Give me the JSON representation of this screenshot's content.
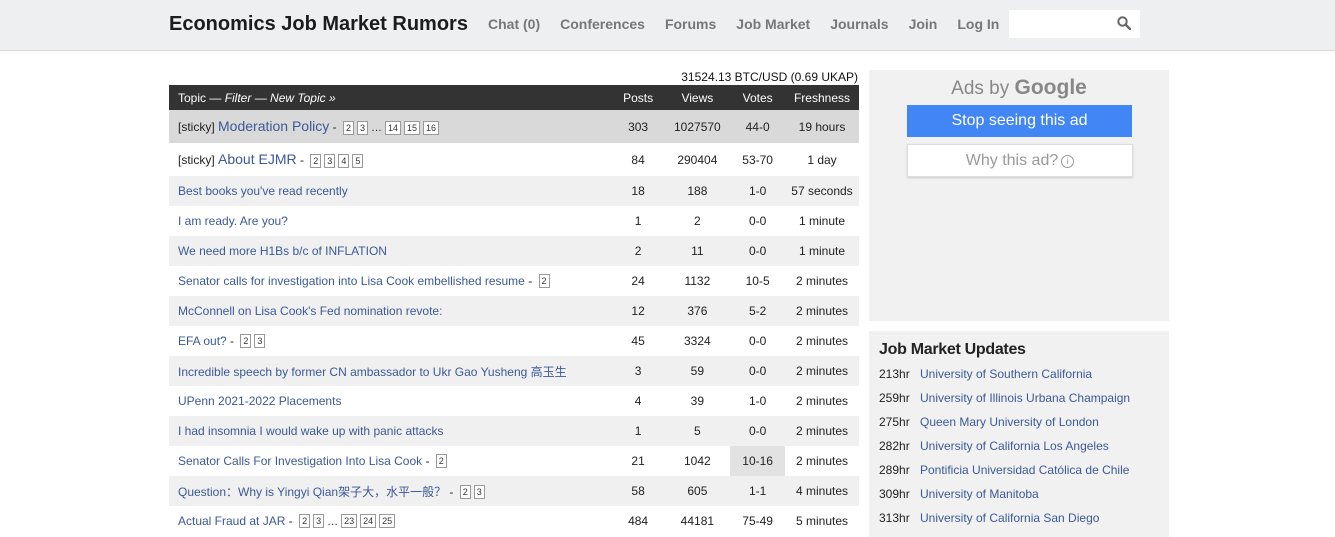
{
  "header": {
    "site_title": "Economics Job Market Rumors",
    "nav": [
      "Chat (0)",
      "Conferences",
      "Forums",
      "Job Market",
      "Journals",
      "Join",
      "Log In"
    ],
    "search_placeholder": ""
  },
  "btc_ticker": "31524.13 BTC/USD (0.69 UKAP)",
  "table": {
    "header": {
      "topic_prefix": "Topic — ",
      "filter": "Filter",
      "sep": " — ",
      "new_topic": "New Topic »",
      "posts": "Posts",
      "views": "Views",
      "votes": "Votes",
      "freshness": "Freshness"
    },
    "rows": [
      {
        "sticky": "[sticky]",
        "title": "Moderation Policy",
        "pages": [
          "2",
          "3",
          "…",
          "14",
          "15",
          "16"
        ],
        "posts": "303",
        "views": "1027570",
        "votes": "44-0",
        "fresh": "19 hours",
        "style": "sticky"
      },
      {
        "sticky": "[sticky]",
        "title": "About EJMR",
        "pages": [
          "2",
          "3",
          "4",
          "5"
        ],
        "posts": "84",
        "views": "290404",
        "votes": "53-70",
        "fresh": "1 day",
        "style": "sticky2"
      },
      {
        "title": "Best books you've read recently",
        "pages": [],
        "posts": "18",
        "views": "188",
        "votes": "1-0",
        "fresh": "57 seconds",
        "style": "alt"
      },
      {
        "title": "I am ready. Are you?",
        "pages": [],
        "posts": "1",
        "views": "2",
        "votes": "0-0",
        "fresh": "1 minute",
        "style": "plain"
      },
      {
        "title": "We need more H1Bs b/c of INFLATION",
        "pages": [],
        "posts": "2",
        "views": "11",
        "votes": "0-0",
        "fresh": "1 minute",
        "style": "alt"
      },
      {
        "title": "Senator calls for investigation into Lisa Cook embellished resume",
        "pages": [
          "2"
        ],
        "posts": "24",
        "views": "1132",
        "votes": "10-5",
        "fresh": "2 minutes",
        "style": "plain"
      },
      {
        "title": "McConnell on Lisa Cook's Fed nomination revote:",
        "pages": [],
        "posts": "12",
        "views": "376",
        "votes": "5-2",
        "fresh": "2 minutes",
        "style": "alt"
      },
      {
        "title": "EFA out?",
        "pages": [
          "2",
          "3"
        ],
        "posts": "45",
        "views": "3324",
        "votes": "0-0",
        "fresh": "2 minutes",
        "style": "plain"
      },
      {
        "title": "Incredible speech by former CN ambassador to Ukr Gao Yusheng 高玉生",
        "pages": [],
        "posts": "3",
        "views": "59",
        "votes": "0-0",
        "fresh": "2 minutes",
        "style": "alt"
      },
      {
        "title": "UPenn 2021-2022 Placements",
        "pages": [],
        "posts": "4",
        "views": "39",
        "votes": "1-0",
        "fresh": "2 minutes",
        "style": "plain"
      },
      {
        "title": "I had insomnia I would wake up with panic attacks",
        "pages": [],
        "posts": "1",
        "views": "5",
        "votes": "0-0",
        "fresh": "2 minutes",
        "style": "alt"
      },
      {
        "title": "Senator Calls For Investigation Into Lisa Cook",
        "pages": [
          "2"
        ],
        "posts": "21",
        "views": "1042",
        "votes": "10-16",
        "fresh": "2 minutes",
        "style": "plain",
        "votes_hl": true
      },
      {
        "title": "Question：Why is Yingyi Qian架子大，水平一般？",
        "pages": [
          "2",
          "3"
        ],
        "posts": "58",
        "views": "605",
        "votes": "1-1",
        "fresh": "4 minutes",
        "style": "alt"
      },
      {
        "title": "Actual Fraud at JAR",
        "pages": [
          "2",
          "3",
          "…",
          "23",
          "24",
          "25"
        ],
        "posts": "484",
        "views": "44181",
        "votes": "75-49",
        "fresh": "5 minutes",
        "style": "plain"
      }
    ]
  },
  "ad": {
    "ads_by": "Ads by ",
    "google": "Google",
    "stop": "Stop seeing this ad",
    "why": "Why this ad?",
    "info_glyph": "i"
  },
  "job_market": {
    "title": "Job Market Updates",
    "items": [
      {
        "time": "213hr",
        "name": "University of Southern California"
      },
      {
        "time": "259hr",
        "name": "University of Illinois Urbana Champaign"
      },
      {
        "time": "275hr",
        "name": "Queen Mary University of London"
      },
      {
        "time": "282hr",
        "name": "University of California Los Angeles"
      },
      {
        "time": "289hr",
        "name": "Pontificia Universidad Católica de Chile"
      },
      {
        "time": "309hr",
        "name": "University of Manitoba"
      },
      {
        "time": "313hr",
        "name": "University of California San Diego"
      }
    ]
  }
}
